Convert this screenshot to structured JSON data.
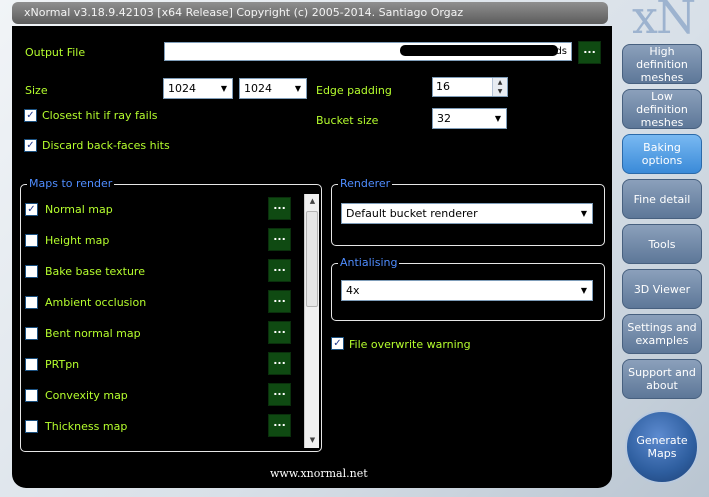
{
  "window": {
    "title": "xNormal v3.18.9.42103 [x64 Release] Copyright (c) 2005-2014. Santiago Orgaz"
  },
  "logo": "xN",
  "output": {
    "label": "Output File",
    "value": "ds",
    "browse": "..."
  },
  "size": {
    "label": "Size",
    "width": "1024",
    "height": "1024"
  },
  "edge_padding": {
    "label": "Edge padding",
    "value": "16"
  },
  "bucket_size": {
    "label": "Bucket size",
    "value": "32"
  },
  "options": {
    "closest_hit": {
      "label": "Closest hit if ray fails",
      "checked": true
    },
    "discard_back": {
      "label": "Discard back-faces hits",
      "checked": true
    },
    "file_overwrite": {
      "label": "File overwrite warning",
      "checked": true
    }
  },
  "maps": {
    "title": "Maps to render",
    "items": [
      {
        "label": "Normal map",
        "checked": true
      },
      {
        "label": "Height map",
        "checked": false
      },
      {
        "label": "Bake base texture",
        "checked": false
      },
      {
        "label": "Ambient occlusion",
        "checked": false
      },
      {
        "label": "Bent normal map",
        "checked": false
      },
      {
        "label": "PRTpn",
        "checked": false
      },
      {
        "label": "Convexity map",
        "checked": false
      },
      {
        "label": "Thickness map",
        "checked": false
      }
    ],
    "settings_button": "..."
  },
  "renderer": {
    "title": "Renderer",
    "value": "Default bucket renderer"
  },
  "antialiasing": {
    "title": "Antialising",
    "value": "4x"
  },
  "site": "www.xnormal.net",
  "sidebar": {
    "items": [
      {
        "label": "High definition meshes"
      },
      {
        "label": "Low definition meshes"
      },
      {
        "label": "Baking options"
      },
      {
        "label": "Fine detail"
      },
      {
        "label": "Tools"
      },
      {
        "label": "3D Viewer"
      },
      {
        "label": "Settings and examples"
      },
      {
        "label": "Support and about"
      }
    ],
    "generate": "Generate Maps"
  },
  "colors": {
    "label_green": "#b6ff2e",
    "group_title_blue": "#4f8dff",
    "active_tab": "#3a8ad8"
  },
  "icons": {
    "check": "✓",
    "dropdown": "▼",
    "spin_up": "▲",
    "spin_down": "▼"
  }
}
